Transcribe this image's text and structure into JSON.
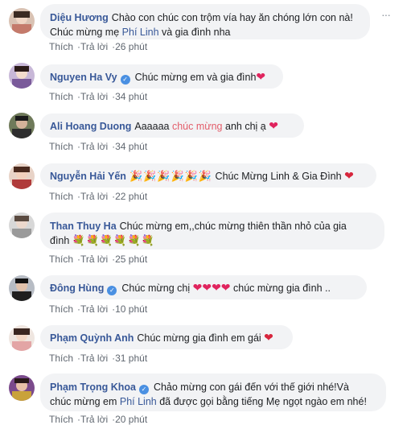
{
  "actions": {
    "like": "Thích",
    "reply": "Trả lời"
  },
  "comments": [
    {
      "author": "Diệu Hương",
      "text1": "Chào con chúc con trộm vía hay ăn chóng lớn con nà!",
      "text2a": "Chúc mừng mẹ ",
      "tag": "Phí Linh",
      "text2b": " và gia đình nha",
      "time": "26 phút",
      "more": "···"
    },
    {
      "author": "Nguyen Ha Vy",
      "text": "Chúc mừng em và gia đình",
      "emoji": "❤",
      "time": "34 phút"
    },
    {
      "author": "Ali Hoang Duong",
      "text1": "Aaaaaa ",
      "highlight": "chúc mừng",
      "text2": " anh chị ạ",
      "emoji": "❤",
      "time": "34 phút"
    },
    {
      "author": "Nguyễn Hải Yến",
      "emoji_party": "🎉🎉🎉🎉🎉🎉",
      "text": " Chúc Mừng Linh & Gia Đình ",
      "emoji": "❤",
      "time": "22 phút"
    },
    {
      "author": "Than Thuy Ha",
      "text1": "Chúc mừng em,,chúc mừng thiên thần nhỏ của gia",
      "text2": "đình",
      "flowers": "💐💐💐💐💐💐",
      "time": "25 phút"
    },
    {
      "author": "Đông Hùng",
      "text1": "Chúc mừng chị ",
      "hearts": "❤❤❤❤",
      "text2": " chúc mừng gia đình ..",
      "time": "10 phút"
    },
    {
      "author": "Phạm Quỳnh Anh",
      "text": "Chúc mừng gia đình em gái ",
      "emoji": "❤",
      "time": "31 phút"
    },
    {
      "author": "Phạm Trọng Khoa",
      "text1": "Chảo mừng con gái đến với thế giới nhé!Và",
      "text2a": "chúc mừng em ",
      "tag": "Phí Linh",
      "text2b": " đã được gọi bằng tiếng Mẹ ngọt ngào em nhé!",
      "time": "20 phút"
    }
  ]
}
